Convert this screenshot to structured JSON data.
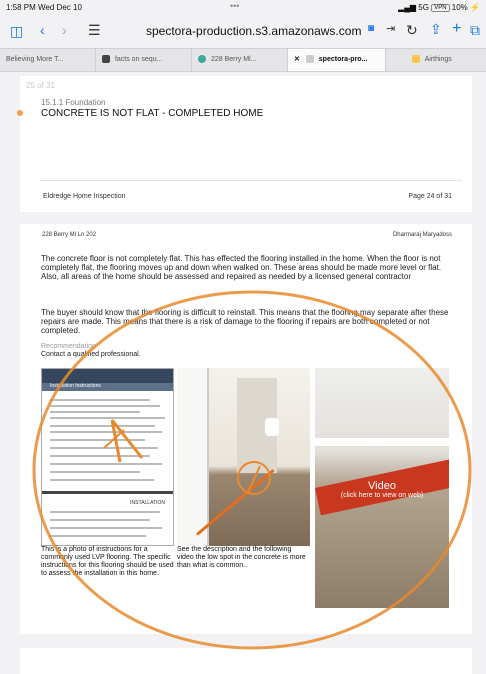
{
  "status_bar": {
    "time": "1:58 PM  Wed Dec 10",
    "signal": "5G",
    "vpn": "VPN",
    "battery": "10%"
  },
  "browser": {
    "url": "spectora-production.s3.amazonaws.com"
  },
  "tabs": [
    {
      "label": "Believing More T..."
    },
    {
      "label": "facts on sequ..."
    },
    {
      "label": "228 Berry Ml..."
    },
    {
      "label": "spectora-pro..."
    },
    {
      "label": "Airthings"
    }
  ],
  "page1": {
    "page_counter": "25 of 31",
    "section_number": "15.1.1 Foundation",
    "section_title": "CONCRETE IS NOT FLAT - COMPLETED HOME",
    "footer_left": "Eldredge Home Inspection",
    "footer_right": "Page 24 of 31"
  },
  "page2": {
    "header_left": "228 Berry Ml Ln 202",
    "header_right": "Dharmaraj Maryadoss",
    "paragraph1": "The concrete floor is not completely flat. This has effected the flooring installed in the home. When the floor is not completely flat, the flooring moves up and down when walked on. These areas should be made more level or flat. Also, all areas of the home should be assessed and repaired as needed by a licensed general contractor",
    "paragraph2": "The buyer should know that the flooring is difficult to reinstall. This means that the flooring may separate after these repairs are made. This means that there is a risk of damage to the flooring if repairs are both completed or not completed.",
    "recommendation_label": "Recommendation",
    "recommendation_text": "Contact a qualified professional.",
    "photo1_banner": "Installation Instructions",
    "photo1_section": "INSTALLATION",
    "caption1": "This is a photo of instructions for a commonly used LVP flooring. The specific instructions for this flooring should be used to assess the installation in this home.",
    "caption2": "See the description and the following video the low spot in the concrete is more than what is common..",
    "video_label": "Video",
    "video_sub": "(click here to view on web)"
  },
  "colors": {
    "accent": "#1a73e8",
    "annotation": "#e8892b",
    "dot": "#f2a24a"
  }
}
